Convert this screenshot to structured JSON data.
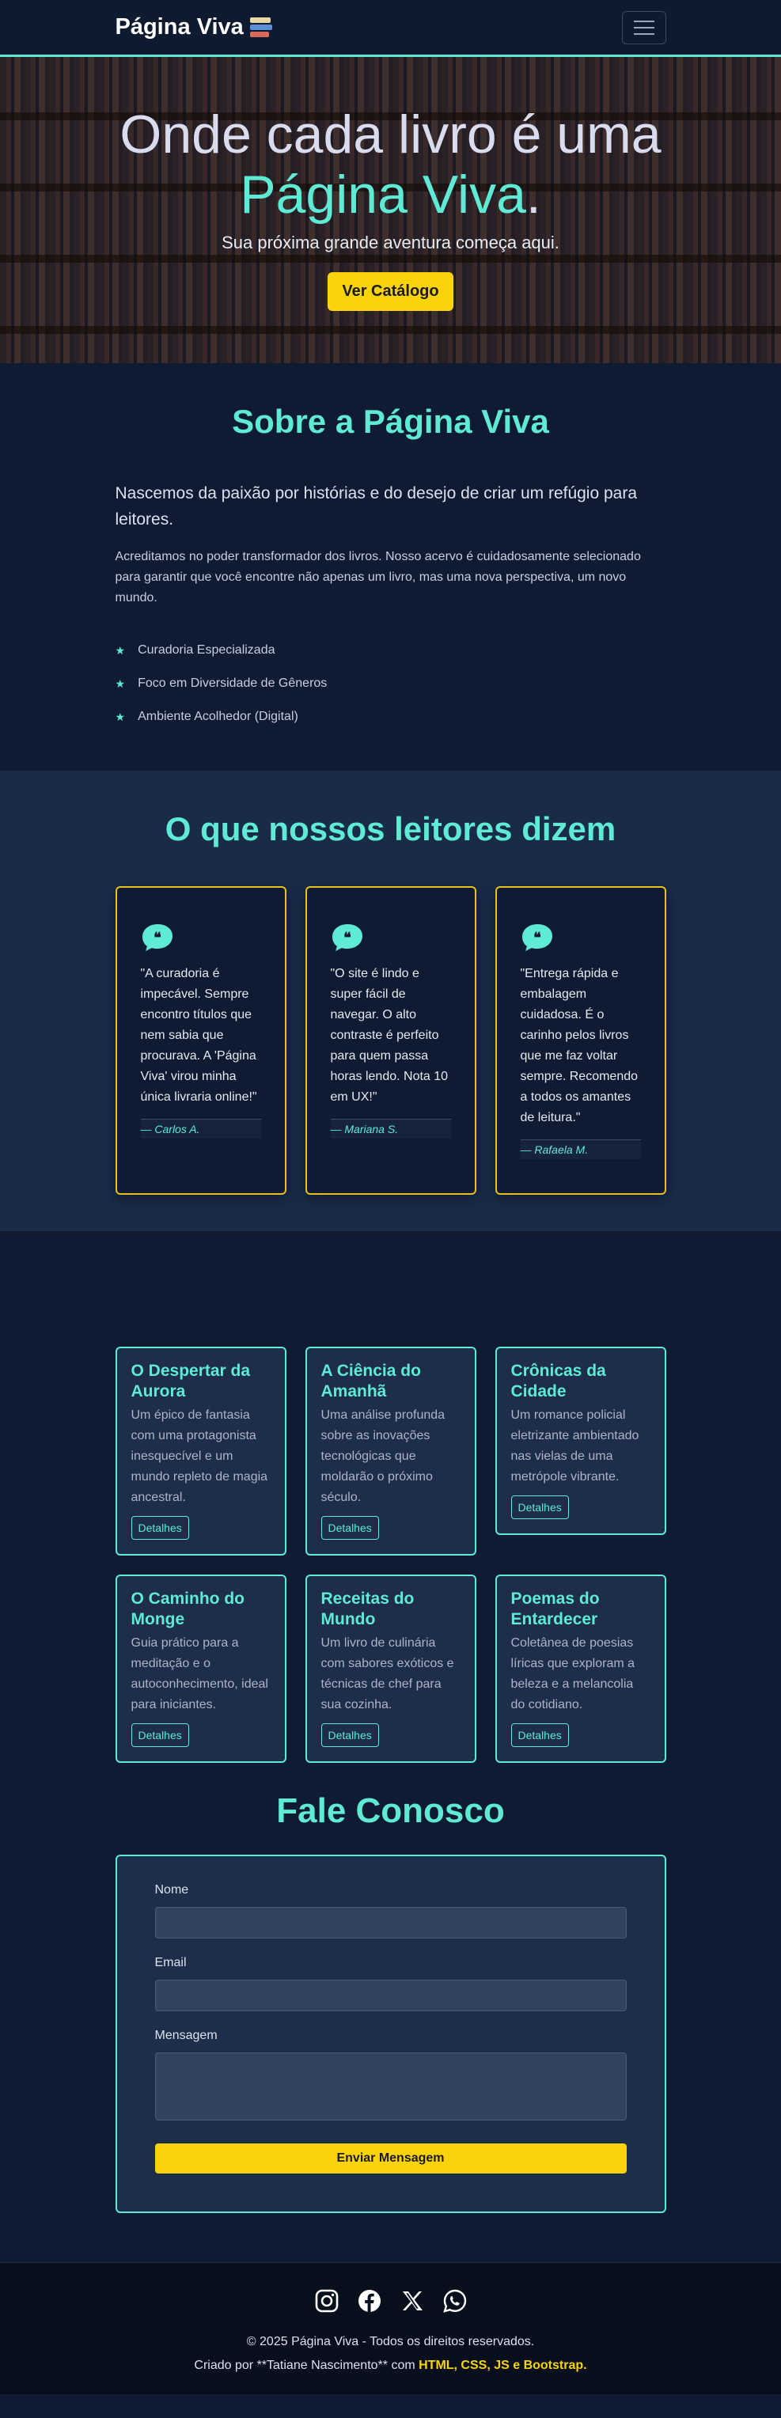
{
  "navbar": {
    "brand": "Página Viva",
    "brand_icon": "books-icon",
    "menu_icon": "hamburger-icon"
  },
  "hero": {
    "title_part1": "Onde cada livro é uma",
    "title_accent": "Página Viva",
    "title_end": ".",
    "subtitle": "Sua próxima grande aventura começa aqui.",
    "cta_label": "Ver Catálogo"
  },
  "about": {
    "title": "Sobre a Página Viva",
    "lead": "Nascemos da paixão por histórias e do desejo de criar um refúgio para leitores.",
    "body": "Acreditamos no poder transformador dos livros. Nosso acervo é cuidadosamente selecionado para garantir que você encontre não apenas um livro, mas uma nova perspectiva, um novo mundo.",
    "features": [
      "Curadoria Especializada",
      "Foco em Diversidade de Gêneros",
      "Ambiente Acolhedor (Digital)"
    ]
  },
  "testimonials": {
    "title": "O que nossos leitores dizem",
    "items": [
      {
        "text": "\"A curadoria é impecável. Sempre encontro títulos que nem sabia que procurava. A 'Página Viva' virou minha única livraria online!\"",
        "author": "— Carlos A."
      },
      {
        "text": "\"O site é lindo e super fácil de navegar. O alto contraste é perfeito para quem passa horas lendo. Nota 10 em UX!\"",
        "author": "— Mariana S."
      },
      {
        "text": "\"Entrega rápida e embalagem cuidadosa. É o carinho pelos livros que me faz voltar sempre. Recomendo a todos os amantes de leitura.\"",
        "author": "— Rafaela M."
      }
    ]
  },
  "books": {
    "button_label": "Detalhes",
    "items": [
      {
        "title": "O Despertar da Aurora",
        "desc": "Um épico de fantasia com uma protagonista inesquecível e um mundo repleto de magia ancestral."
      },
      {
        "title": "A Ciência do Amanhã",
        "desc": "Uma análise profunda sobre as inovações tecnológicas que moldarão o próximo século."
      },
      {
        "title": "Crônicas da Cidade",
        "desc": "Um romance policial eletrizante ambientado nas vielas de uma metrópole vibrante."
      },
      {
        "title": "O Caminho do Monge",
        "desc": "Guia prático para a meditação e o autoconhecimento, ideal para iniciantes."
      },
      {
        "title": "Receitas do Mundo",
        "desc": "Um livro de culinária com sabores exóticos e técnicas de chef para sua cozinha."
      },
      {
        "title": "Poemas do Entardecer",
        "desc": "Coletânea de poesias líricas que exploram a beleza e a melancolia do cotidiano."
      }
    ]
  },
  "contact": {
    "title": "Fale Conosco",
    "name_label": "Nome",
    "email_label": "Email",
    "message_label": "Mensagem",
    "submit_label": "Enviar Mensagem"
  },
  "footer": {
    "socials": [
      "instagram-icon",
      "facebook-icon",
      "x-icon",
      "whatsapp-icon"
    ],
    "copyright": "© 2025 Página Viva - Todos os direitos reservados.",
    "credit_prefix": "Criado por **Tatiane Nascimento** com ",
    "credit_tech": "HTML, CSS, JS e Bootstrap."
  },
  "colors": {
    "background": "#0f1b33",
    "accent": "#5eead4",
    "highlight": "#fbd30a"
  }
}
